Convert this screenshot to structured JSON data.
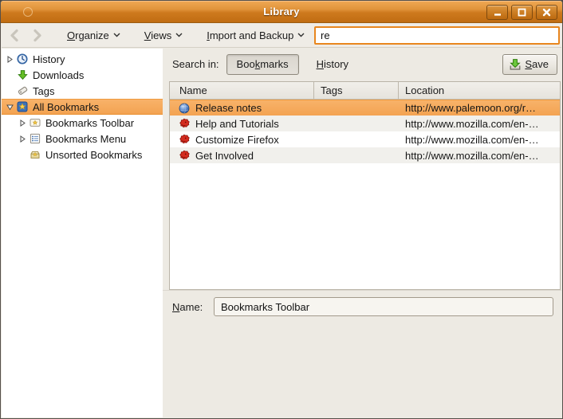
{
  "window": {
    "title": "Library"
  },
  "toolbar": {
    "organize": {
      "key": "O",
      "post": "rganize"
    },
    "views": {
      "key": "V",
      "post": "iews"
    },
    "import_backup": {
      "key": "I",
      "post": "mport and Backup"
    },
    "search": {
      "value": "re"
    }
  },
  "sidebar": {
    "items": [
      {
        "label": "History",
        "icon": "history-clock-icon",
        "expander": "collapsed"
      },
      {
        "label": "Downloads",
        "icon": "downloads-icon"
      },
      {
        "label": "Tags",
        "icon": "tags-icon"
      },
      {
        "label": "All Bookmarks",
        "icon": "all-bookmarks-icon",
        "expander": "expanded",
        "selected": true
      },
      {
        "label": "Bookmarks Toolbar",
        "icon": "bookmarks-toolbar-icon",
        "expander": "collapsed"
      },
      {
        "label": "Bookmarks Menu",
        "icon": "bookmarks-menu-icon",
        "expander": "collapsed"
      },
      {
        "label": "Unsorted Bookmarks",
        "icon": "unsorted-bookmarks-icon"
      }
    ]
  },
  "main": {
    "search_in_label": "Search in:",
    "scope": {
      "bookmarks": {
        "pre": "Boo",
        "key": "k",
        "post": "marks",
        "pressed": true
      },
      "history": {
        "key": "H",
        "post": "istory",
        "pressed": false
      }
    },
    "save": {
      "key": "S",
      "post": "ave"
    },
    "table": {
      "columns": [
        "Name",
        "Tags",
        "Location"
      ],
      "rows": [
        {
          "name": "Release notes",
          "tags": "",
          "location": "http://www.palemoon.org/r…",
          "icon": "globe-icon",
          "selected": true
        },
        {
          "name": "Help and Tutorials",
          "tags": "",
          "location": "http://www.mozilla.com/en-…",
          "icon": "mozilla-icon"
        },
        {
          "name": "Customize Firefox",
          "tags": "",
          "location": "http://www.mozilla.com/en-…",
          "icon": "mozilla-icon"
        },
        {
          "name": "Get Involved",
          "tags": "",
          "location": "http://www.mozilla.com/en-…",
          "icon": "mozilla-icon"
        }
      ]
    },
    "detail": {
      "name_label": {
        "key": "N",
        "post": "ame:"
      },
      "name_value": "Bookmarks Toolbar"
    }
  },
  "colors": {
    "titlebar_orange": "#CE7A1E",
    "selection_orange": "#F5A95C",
    "search_focus_border": "#E8861E",
    "window_bg": "#EDEAE3"
  }
}
